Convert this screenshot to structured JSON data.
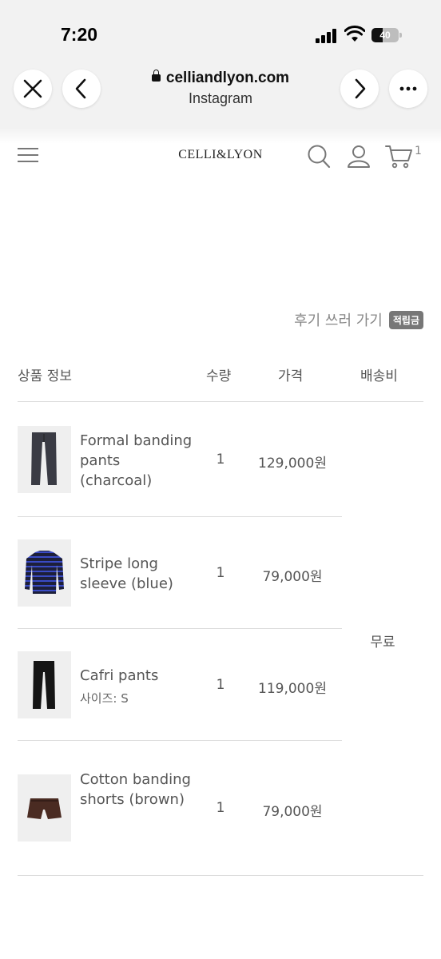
{
  "status_bar": {
    "time": "7:20",
    "battery": "40"
  },
  "browser": {
    "domain": "celliandlyon.com",
    "subtitle": "Instagram"
  },
  "site": {
    "logo": "CELLI&LYON",
    "cart_count": "1"
  },
  "review": {
    "label": "후기 쓰러 가기",
    "badge": "적립금"
  },
  "table": {
    "headers": {
      "product": "상품 정보",
      "qty": "수량",
      "price": "가격",
      "shipping": "배송비"
    },
    "shipping_value": "무료",
    "items": [
      {
        "name": "Formal banding pants (charcoal)",
        "option": "",
        "qty": "1",
        "price": "129,000원"
      },
      {
        "name": "Stripe long sleeve (blue)",
        "option": "",
        "qty": "1",
        "price": "79,000원"
      },
      {
        "name": "Cafri pants",
        "option": "사이즈: S",
        "qty": "1",
        "price": "119,000원"
      },
      {
        "name": "Cotton banding shorts (brown)",
        "option": "",
        "qty": "1",
        "price": "79,000원"
      }
    ]
  }
}
